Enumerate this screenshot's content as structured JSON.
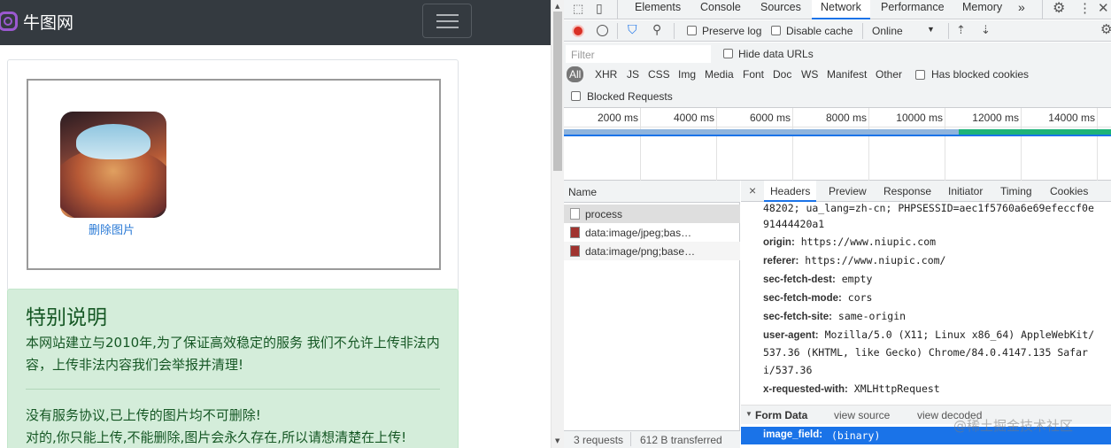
{
  "site": {
    "brand": "牛图网",
    "delete_link": "删除图片",
    "notice_title": "特别说明",
    "notice_p1": "本网站建立与2010年,为了保证高效稳定的服务 我们不允许上传非法内容，上传非法内容我们会举报并清理!",
    "notice_p2_line1": "没有服务协议,已上传的图片均不可删除!",
    "notice_p2_line2": "对的,你只能上传,不能删除,图片会永久存在,所以请想清楚在上传!"
  },
  "devtools": {
    "tabs": [
      "Elements",
      "Console",
      "Sources",
      "Network",
      "Performance",
      "Memory",
      "»"
    ],
    "active_tab": "Network",
    "toolbar": {
      "preserve_log": "Preserve log",
      "disable_cache": "Disable cache",
      "throttle": "Online"
    },
    "filter": {
      "placeholder": "Filter",
      "hide_data_urls": "Hide data URLs",
      "types": [
        "All",
        "XHR",
        "JS",
        "CSS",
        "Img",
        "Media",
        "Font",
        "Doc",
        "WS",
        "Manifest",
        "Other"
      ],
      "has_blocked_cookies": "Has blocked cookies",
      "blocked_requests": "Blocked Requests"
    },
    "timeline_ticks": [
      "2000 ms",
      "4000 ms",
      "6000 ms",
      "8000 ms",
      "10000 ms",
      "12000 ms",
      "14000 ms"
    ],
    "requests": {
      "header": "Name",
      "items": [
        "process",
        "data:image/jpeg;bas…",
        "data:image/png;base…"
      ],
      "status": "3 requests",
      "transferred": "612 B transferred"
    },
    "detail": {
      "close": "×",
      "tabs": [
        "Headers",
        "Preview",
        "Response",
        "Initiator",
        "Timing",
        "Cookies"
      ],
      "active_tab": "Headers",
      "cookie_tail_1": "48202; ua_lang=zh-cn; PHPSESSID=aec1f5760a6e69efeccf0e",
      "cookie_tail_2": "91444420a1",
      "headers": [
        {
          "name": "origin:",
          "value": "https://www.niupic.com"
        },
        {
          "name": "referer:",
          "value": "https://www.niupic.com/"
        },
        {
          "name": "sec-fetch-dest:",
          "value": "empty"
        },
        {
          "name": "sec-fetch-mode:",
          "value": "cors"
        },
        {
          "name": "sec-fetch-site:",
          "value": "same-origin"
        },
        {
          "name": "user-agent:",
          "value": "Mozilla/5.0 (X11; Linux x86_64) AppleWebKit/"
        },
        {
          "name": "",
          "value": "537.36 (KHTML, like Gecko) Chrome/84.0.4147.135 Safar"
        },
        {
          "name": "",
          "value": "i/537.36"
        },
        {
          "name": "x-requested-with:",
          "value": "XMLHttpRequest"
        }
      ],
      "form_data_label": "Form Data",
      "view_source": "view source",
      "view_decoded": "view decoded",
      "form_field_name": "image_field:",
      "form_field_value": "(binary)"
    },
    "watermark": "@稀土掘金技术社区"
  }
}
